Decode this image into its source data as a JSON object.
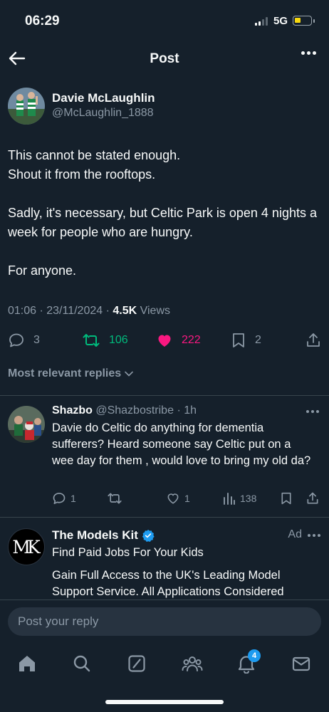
{
  "status": {
    "time": "06:29",
    "network": "5G"
  },
  "header": {
    "title": "Post"
  },
  "post": {
    "author_name": "Davie McLaughlin",
    "author_handle": "@McLaughlin_1888",
    "body": [
      "This cannot be stated enough.",
      "Shout it from the rooftops.",
      "Sadly, it's necessary, but Celtic Park is open 4 nights a week for people who are hungry.",
      "For anyone."
    ],
    "timestamp": "01:06 · 23/11/2024 · ",
    "views_count": "4.5K",
    "views_label": " Views",
    "replies": "3",
    "reposts": "106",
    "likes": "222",
    "bookmarks": "2"
  },
  "replies_sort_label": "Most relevant replies",
  "reply": {
    "name": "Shazbo",
    "handle": "@Shazbostribe",
    "time": "· 1h",
    "text": "Davie do Celtic do anything for dementia sufferers? Heard someone say Celtic put on a wee day for them , would love to bring my old da?",
    "replies": "1",
    "reposts": "",
    "likes": "1",
    "views": "138"
  },
  "ad": {
    "logo_text": "MK",
    "name": "The Models Kit",
    "label": "Ad",
    "headline": "Find Paid Jobs For Your Kids",
    "description": "Gain Full Access to the UK's Leading Model Support Service. All Applications Considered"
  },
  "composer": {
    "placeholder": "Post your reply"
  },
  "nav": {
    "notifications_badge": "4"
  },
  "colors": {
    "background": "#15202b",
    "repost_green": "#00ba7c",
    "like_pink": "#f91880",
    "verified_blue": "#1d9bf0",
    "muted_text": "#8b98a5"
  },
  "icons": {
    "header": [
      "back-arrow-icon",
      "more-icon"
    ],
    "post_actions": [
      "reply-icon",
      "repost-icon",
      "heart-filled-icon",
      "bookmark-icon",
      "share-icon"
    ],
    "nav": [
      "home-icon",
      "search-icon",
      "grok-icon",
      "communities-icon",
      "notifications-icon",
      "messages-icon"
    ]
  }
}
